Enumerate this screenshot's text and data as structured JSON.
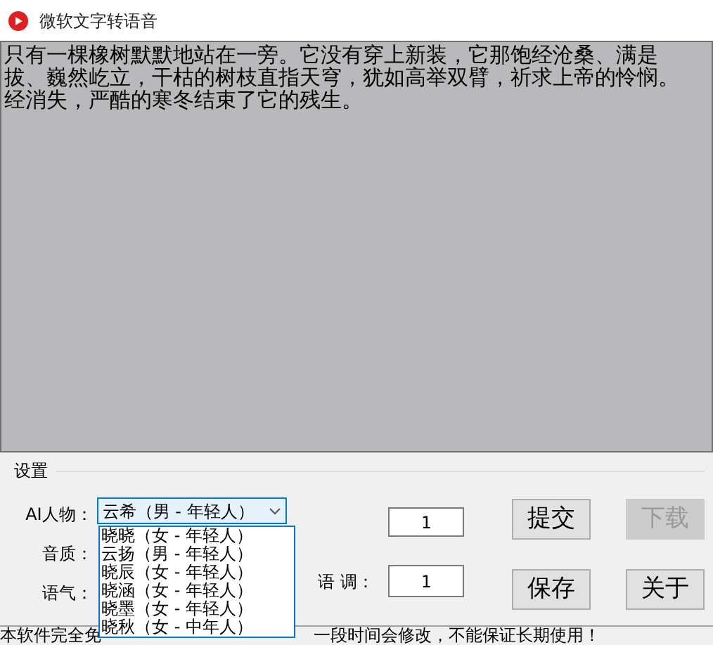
{
  "window": {
    "title": "微软文字转语音"
  },
  "editor": {
    "lines": [
      "只有一棵橡树默默地站在一旁。它没有穿上新装，它那饱经沧桑、满是",
      "拔、巍然屹立，干枯的树枝直指天穹，犹如高举双臂，祈求上帝的怜悯。",
      "经消失，严酷的寒冬结束了它的残生。"
    ]
  },
  "settings": {
    "title": "设置",
    "labels": [
      "AI人物：",
      "音质：",
      "语气："
    ],
    "voice": {
      "value": "云希（男 - 年轻人）",
      "expanded": true,
      "options": [
        {
          "label": "晓晓（女 - 年轻人）",
          "selected": false
        },
        {
          "label": "云扬（男 - 年轻人）",
          "selected": false
        },
        {
          "label": "晓辰（女 - 年轻人）",
          "selected": false
        },
        {
          "label": "晓涵（女 - 年轻人）",
          "selected": false
        },
        {
          "label": "晓墨（女 - 年轻人）",
          "selected": false
        },
        {
          "label": "晓秋（女 - 中年人）",
          "selected": false
        }
      ]
    },
    "speed_field": {
      "value": "1"
    },
    "pitch": {
      "label": "语 调：",
      "value": "1"
    },
    "buttons": [
      {
        "label": "提交",
        "disabled": false
      },
      {
        "label": "下载",
        "disabled": true
      },
      {
        "label": "保存",
        "disabled": false
      },
      {
        "label": "关于",
        "disabled": false
      }
    ]
  },
  "status_bar": {
    "left": "本软件完全免",
    "right": "一段时间会修改，不能保证长期使用！"
  }
}
